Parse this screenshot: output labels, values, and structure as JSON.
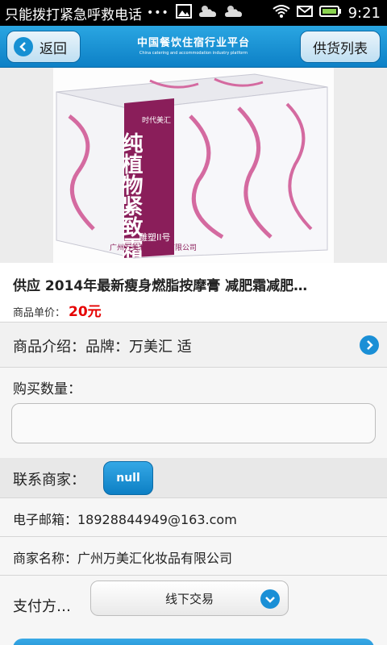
{
  "status_bar": {
    "notice": "只能拨打紧急呼救电话",
    "dots": "•••",
    "time": "9:21"
  },
  "header": {
    "back_label": "返回",
    "title_cn": "中国餐饮住宿行业平台",
    "title_en": "China catering and accommodation industry platform",
    "supply_label": "供货列表"
  },
  "product": {
    "image_box_text": "纯植物紧致霜",
    "image_box_sub": "雕塑II号",
    "image_box_brand": "时代美汇",
    "image_box_maker": "广州万美汇化妆品有限公司",
    "title": "供应 2014年最新瘦身燃脂按摩膏 减肥霜减肥…",
    "price_label": "商品单价：",
    "price_value": "20元"
  },
  "intro": {
    "text": "商品介绍：品牌：万美汇 适"
  },
  "quantity": {
    "label": "购买数量：",
    "value": "",
    "placeholder": ""
  },
  "contact": {
    "label": "联系商家：",
    "button_label": "null"
  },
  "email": {
    "text": "电子邮箱：18928844949@163.com"
  },
  "merchant": {
    "text": "商家名称：广州万美汇化妆品有限公司"
  },
  "payment": {
    "label": "支付方…",
    "selected": "线下交易"
  },
  "colors": {
    "header_blue": "#1690d3",
    "price_red": "#e60000",
    "box_purple": "#8a1e5a"
  }
}
